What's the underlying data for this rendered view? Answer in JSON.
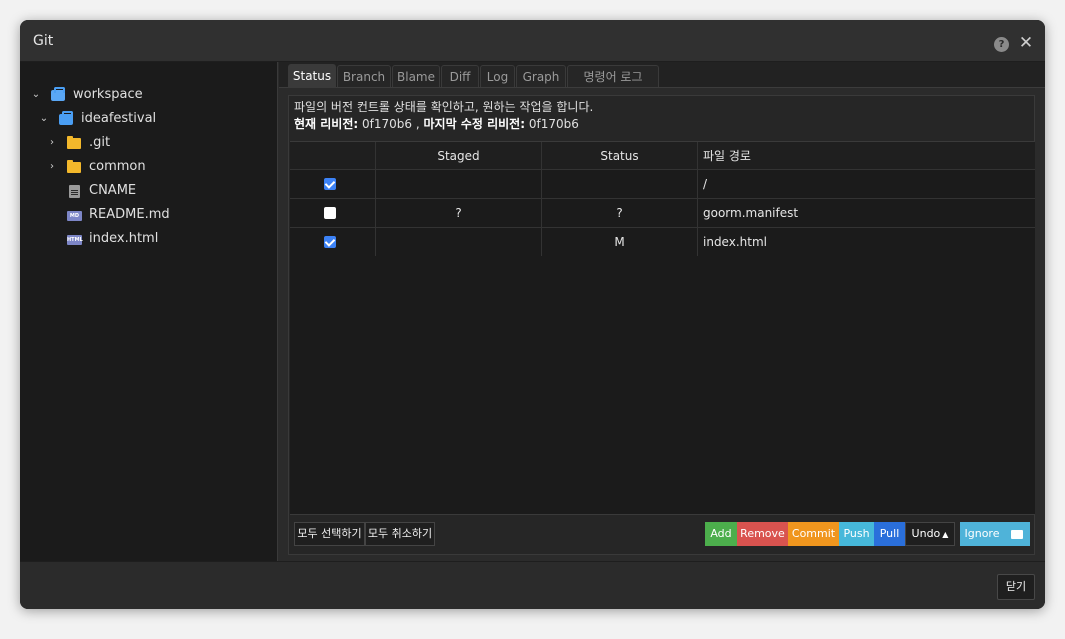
{
  "window": {
    "title": "Git"
  },
  "tree": {
    "workspace": "workspace",
    "project": "ideafestival",
    "items": [
      ".git",
      "common",
      "CNAME",
      "README.md",
      "index.html"
    ],
    "md_tag": "MD",
    "html_tag": "HTML"
  },
  "tabs": [
    "Status",
    "Branch",
    "Blame",
    "Diff",
    "Log",
    "Graph",
    "명령어 로그"
  ],
  "info": {
    "description": "파일의 버전 컨트롤 상태를 확인하고, 원하는 작업을 합니다.",
    "current_label": "현재 리비전:",
    "current_value": "0f170b6",
    "separator": ",",
    "last_label": "마지막 수정 리비전:",
    "last_value": "0f170b6"
  },
  "table": {
    "headers": [
      "",
      "Staged",
      "Status",
      "파일 경로"
    ],
    "rows": [
      {
        "checked": true,
        "staged": "",
        "status": "",
        "path": "/"
      },
      {
        "checked": false,
        "staged": "?",
        "status": "?",
        "path": "goorm.manifest"
      },
      {
        "checked": true,
        "staged": "",
        "status": "M",
        "path": "index.html"
      }
    ]
  },
  "buttons": {
    "select_all": "모두 선택하기",
    "deselect_all": "모두 취소하기",
    "add": "Add",
    "remove": "Remove",
    "commit": "Commit",
    "push": "Push",
    "pull": "Pull",
    "undo": "Undo",
    "ignore": "Ignore",
    "close": "닫기"
  },
  "colors": {
    "add": "#4cae4c",
    "remove": "#d9534f",
    "commit": "#f0961e",
    "push": "#46b8da",
    "pull": "#2a6fdb",
    "ignore": "#4fb3d9",
    "checkbox_on": "#3c82f6"
  },
  "icons": {
    "folder": "folder-icon",
    "workspace": "briefcase-icon",
    "file": "file-icon",
    "help": "help-icon",
    "close": "close-icon",
    "undo_caret": "caret-up-icon",
    "folder_add": "folder-plus-icon"
  }
}
